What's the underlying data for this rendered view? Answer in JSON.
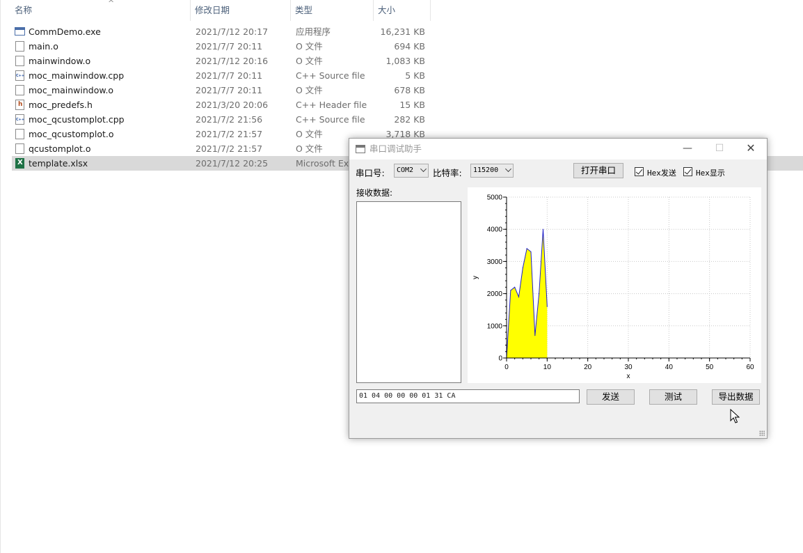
{
  "explorer": {
    "columns": {
      "name": "名称",
      "date": "修改日期",
      "type": "类型",
      "size": "大小"
    },
    "sort_arrow": "^",
    "files": [
      {
        "name": "CommDemo.exe",
        "date": "2021/7/12 20:17",
        "type": "应用程序",
        "size": "16,231 KB",
        "icon": "exe-icon"
      },
      {
        "name": "main.o",
        "date": "2021/7/7 20:11",
        "type": "O 文件",
        "size": "694 KB",
        "icon": "file-icon"
      },
      {
        "name": "mainwindow.o",
        "date": "2021/7/12 20:16",
        "type": "O 文件",
        "size": "1,083 KB",
        "icon": "file-icon"
      },
      {
        "name": "moc_mainwindow.cpp",
        "date": "2021/7/7 20:11",
        "type": "C++ Source file",
        "size": "5 KB",
        "icon": "cpp-file-icon"
      },
      {
        "name": "moc_mainwindow.o",
        "date": "2021/7/7 20:11",
        "type": "O 文件",
        "size": "678 KB",
        "icon": "file-icon"
      },
      {
        "name": "moc_predefs.h",
        "date": "2021/3/20 20:06",
        "type": "C++ Header file",
        "size": "15 KB",
        "icon": "header-file-icon"
      },
      {
        "name": "moc_qcustomplot.cpp",
        "date": "2021/7/2 21:56",
        "type": "C++ Source file",
        "size": "282 KB",
        "icon": "cpp-file-icon"
      },
      {
        "name": "moc_qcustomplot.o",
        "date": "2021/7/2 21:57",
        "type": "O 文件",
        "size": "3,718 KB",
        "icon": "file-icon"
      },
      {
        "name": "qcustomplot.o",
        "date": "2021/7/2 21:57",
        "type": "O 文件",
        "size": "",
        "icon": "file-icon"
      },
      {
        "name": "template.xlsx",
        "date": "2021/7/12 20:25",
        "type": "Microsoft Exc",
        "size": "",
        "icon": "excel-file-icon",
        "selected": true
      }
    ]
  },
  "window": {
    "title": "串口调试助手",
    "minimize": "—",
    "maximize": "☐",
    "close": "✕",
    "port_label": "串口号:",
    "port_value": "COM2",
    "baud_label": "比特率:",
    "baud_value": "115200",
    "open_button": "打开串口",
    "hex_send_label": "Hex发送",
    "hex_send_checked": true,
    "hex_display_label": "Hex显示",
    "hex_display_checked": true,
    "recv_label": "接收数据:",
    "send_input_value": "01 04 00 00 00 01 31 CA",
    "send_button": "发送",
    "test_button": "测试",
    "export_button": "导出数据"
  },
  "chart_data": {
    "type": "area",
    "x": [
      0,
      1,
      2,
      3,
      4,
      5,
      6,
      7,
      8,
      9,
      10
    ],
    "y": [
      0,
      2100,
      2200,
      1900,
      2800,
      3400,
      3300,
      700,
      2000,
      4000,
      1600
    ],
    "xlabel": "x",
    "ylabel": "y",
    "xlim": [
      0,
      60
    ],
    "ylim": [
      0,
      5000
    ],
    "xticks": [
      0,
      10,
      20,
      30,
      40,
      50,
      60
    ],
    "yticks": [
      0,
      1000,
      2000,
      3000,
      4000,
      5000
    ],
    "grid": true,
    "fill_color": "#ffff00",
    "line_color": "#1f1fcc"
  }
}
